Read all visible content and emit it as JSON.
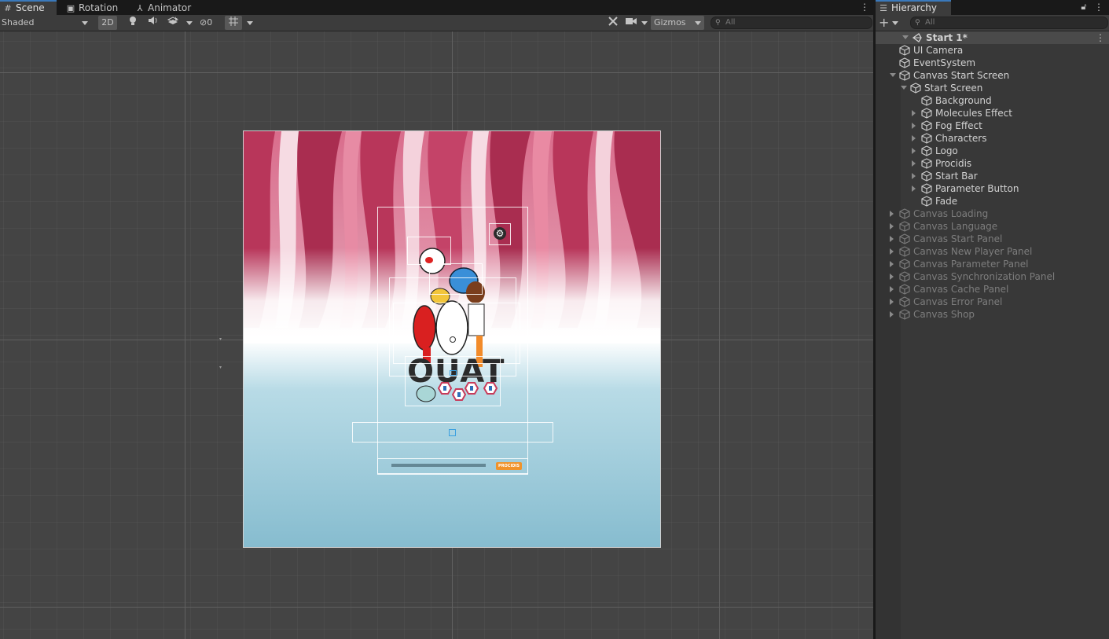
{
  "scene_tabs": [
    {
      "label": "Scene",
      "icon": "grid-icon"
    },
    {
      "label": "Rotation",
      "icon": "animation-clip-icon"
    },
    {
      "label": "Animator",
      "icon": "animator-icon"
    }
  ],
  "toolbar": {
    "shading_mode": "Shaded",
    "mode_2d": "2D",
    "hidden_count": "0",
    "gizmos_label": "Gizmos",
    "search_placeholder": "All"
  },
  "hierarchy": {
    "tab_label": "Hierarchy",
    "add_label": "+",
    "search_placeholder": "All",
    "scene_name": "Start 1*",
    "items": [
      {
        "label": "UI Camera",
        "depth": 1,
        "expander": "none",
        "active": true
      },
      {
        "label": "EventSystem",
        "depth": 1,
        "expander": "none",
        "active": true
      },
      {
        "label": "Canvas Start Screen",
        "depth": 1,
        "expander": "down",
        "active": true
      },
      {
        "label": "Start Screen",
        "depth": 2,
        "expander": "down",
        "active": true
      },
      {
        "label": "Background",
        "depth": 3,
        "expander": "none",
        "active": true
      },
      {
        "label": "Molecules Effect",
        "depth": 3,
        "expander": "right",
        "active": true
      },
      {
        "label": "Fog Effect",
        "depth": 3,
        "expander": "right",
        "active": true
      },
      {
        "label": "Characters",
        "depth": 3,
        "expander": "right",
        "active": true
      },
      {
        "label": "Logo",
        "depth": 3,
        "expander": "right",
        "active": true
      },
      {
        "label": "Procidis",
        "depth": 3,
        "expander": "right",
        "active": true
      },
      {
        "label": "Start Bar",
        "depth": 3,
        "expander": "right",
        "active": true
      },
      {
        "label": "Parameter Button",
        "depth": 3,
        "expander": "right",
        "active": true
      },
      {
        "label": "Fade",
        "depth": 3,
        "expander": "none",
        "active": true
      },
      {
        "label": "Canvas Loading",
        "depth": 1,
        "expander": "right",
        "active": false
      },
      {
        "label": "Canvas Language",
        "depth": 1,
        "expander": "right",
        "active": false
      },
      {
        "label": "Canvas Start Panel",
        "depth": 1,
        "expander": "right",
        "active": false
      },
      {
        "label": "Canvas New Player Panel",
        "depth": 1,
        "expander": "right",
        "active": false
      },
      {
        "label": "Canvas Parameter Panel",
        "depth": 1,
        "expander": "right",
        "active": false
      },
      {
        "label": "Canvas Synchronization Panel",
        "depth": 1,
        "expander": "right",
        "active": false
      },
      {
        "label": "Canvas Cache Panel",
        "depth": 1,
        "expander": "right",
        "active": false
      },
      {
        "label": "Canvas Error Panel",
        "depth": 1,
        "expander": "right",
        "active": false
      },
      {
        "label": "Canvas Shop",
        "depth": 1,
        "expander": "right",
        "active": false
      }
    ]
  },
  "scene_content": {
    "logo_text": "OUAT",
    "brand_badge": "PROCIDIS"
  },
  "colors": {
    "accent": "#3a79bb",
    "background_top": "#b8365a",
    "background_bottom": "#86bccf"
  }
}
